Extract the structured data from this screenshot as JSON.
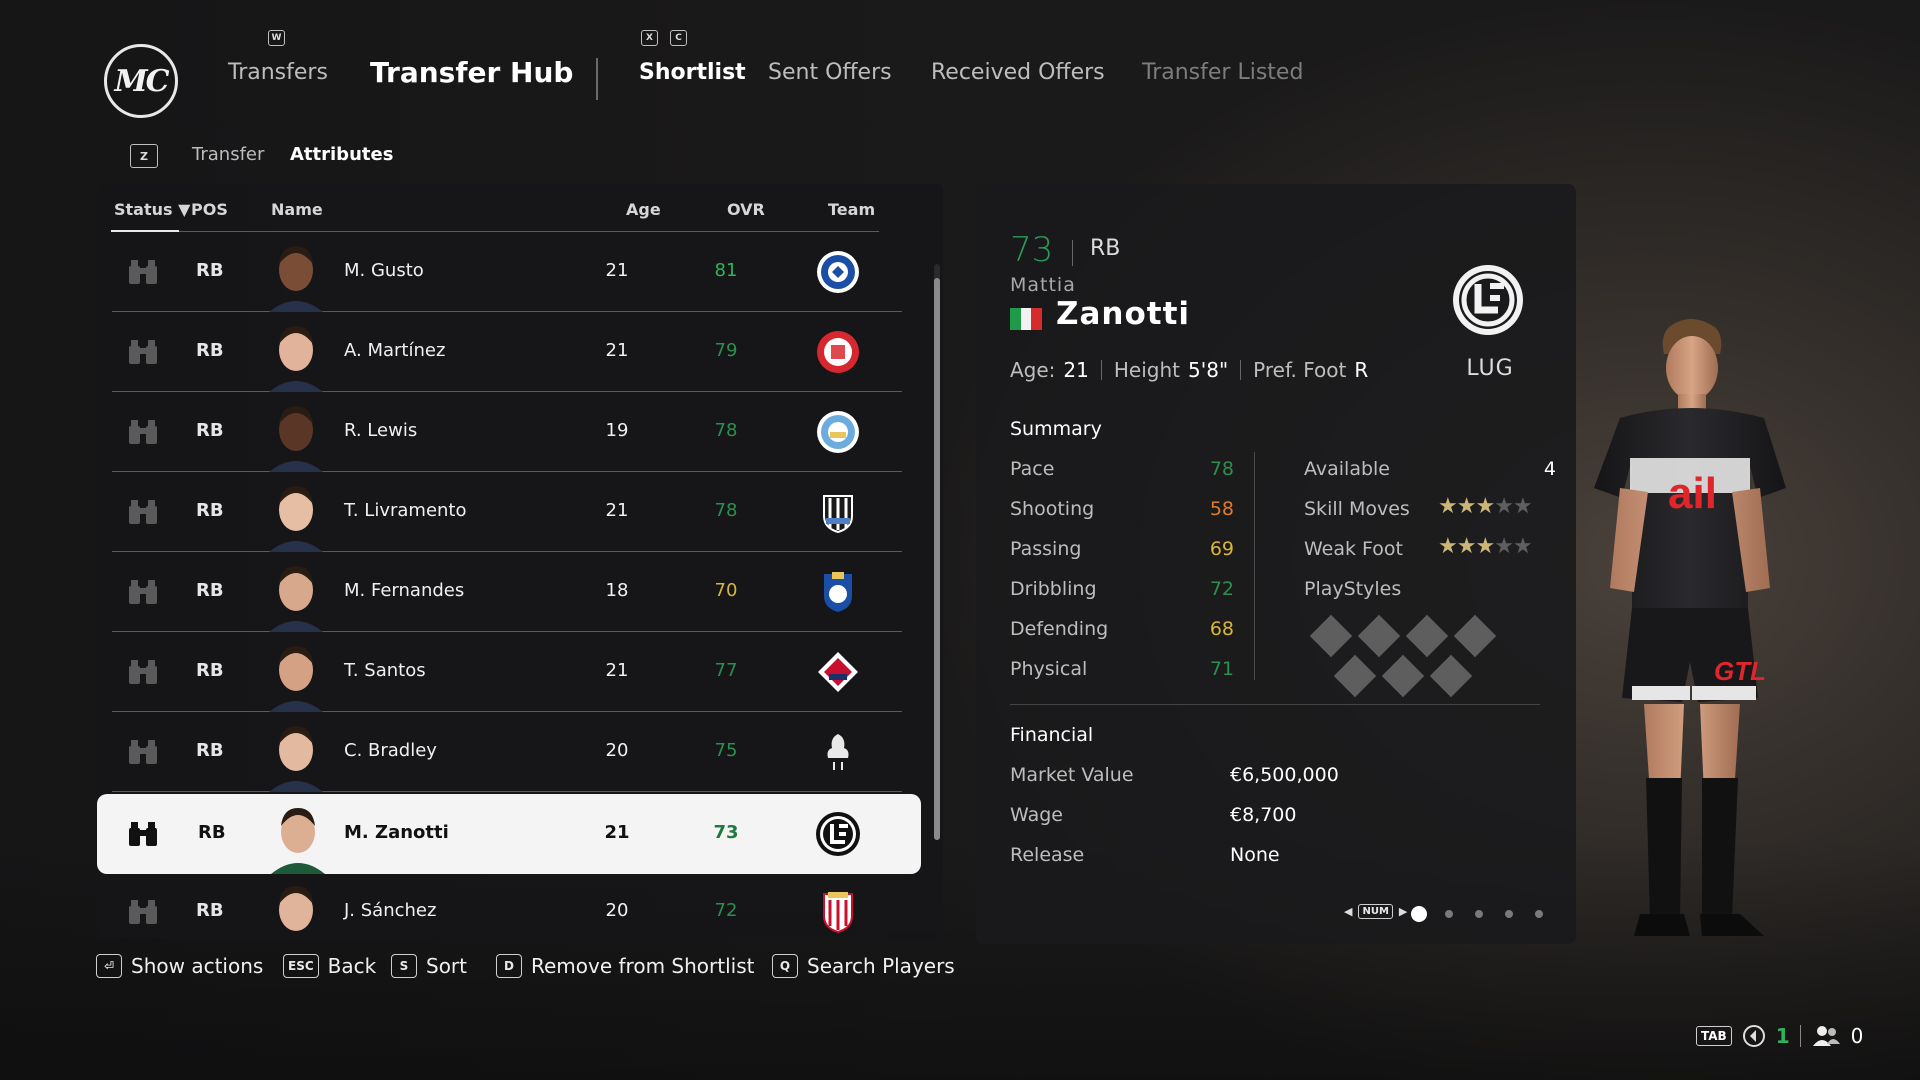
{
  "header": {
    "logo_text": "MC",
    "key_transfers": "W",
    "key_tabs_left": "X",
    "key_tabs_right": "C",
    "transfers": "Transfers",
    "title": "Transfer Hub",
    "tabs": [
      {
        "label": "Shortlist",
        "state": "active"
      },
      {
        "label": "Sent Offers",
        "state": "normal"
      },
      {
        "label": "Received Offers",
        "state": "normal"
      },
      {
        "label": "Transfer Listed",
        "state": "dim"
      }
    ]
  },
  "subnav": {
    "key": "Z",
    "transfer": "Transfer",
    "attributes": "Attributes"
  },
  "table": {
    "headers": {
      "status": "Status",
      "pos": "POS",
      "name": "Name",
      "age": "Age",
      "ovr": "OVR",
      "team": "Team"
    },
    "rows": [
      {
        "pos": "RB",
        "name": "M. Gusto",
        "age": "21",
        "ovr": "81",
        "ovr_color": "#2db35d",
        "club_icon": "chelsea-crest-icon",
        "skin": "#7a4e36"
      },
      {
        "pos": "RB",
        "name": "A. Martínez",
        "age": "21",
        "ovr": "79",
        "ovr_color": "#2d8f4f",
        "club_icon": "girona-crest-icon",
        "skin": "#e0b39a"
      },
      {
        "pos": "RB",
        "name": "R. Lewis",
        "age": "19",
        "ovr": "78",
        "ovr_color": "#2d8f4f",
        "club_icon": "man-city-crest-icon",
        "skin": "#5a3626"
      },
      {
        "pos": "RB",
        "name": "T. Livramento",
        "age": "21",
        "ovr": "78",
        "ovr_color": "#2d8f4f",
        "club_icon": "newcastle-crest-icon",
        "skin": "#e6bea4"
      },
      {
        "pos": "RB",
        "name": "M. Fernandes",
        "age": "18",
        "ovr": "70",
        "ovr_color": "#d9b63a",
        "club_icon": "porto-crest-icon",
        "skin": "#d8a88c"
      },
      {
        "pos": "RB",
        "name": "T. Santos",
        "age": "21",
        "ovr": "77",
        "ovr_color": "#2d8f4f",
        "club_icon": "lille-crest-icon",
        "skin": "#d4a184"
      },
      {
        "pos": "RB",
        "name": "C. Bradley",
        "age": "20",
        "ovr": "75",
        "ovr_color": "#2d8f4f",
        "club_icon": "liverpool-crest-icon",
        "skin": "#e3b9a0"
      },
      {
        "pos": "RB",
        "name": "M. Zanotti",
        "age": "21",
        "ovr": "73",
        "ovr_color": "#1e7a3e",
        "club_icon": "lugano-crest-icon",
        "skin": "#dcae92",
        "selected": true
      },
      {
        "pos": "RB",
        "name": "J. Sánchez",
        "age": "20",
        "ovr": "72",
        "ovr_color": "#2d8f4f",
        "club_icon": "sevilla-crest-icon",
        "skin": "#e0b49a"
      }
    ]
  },
  "detail": {
    "ovr": "73",
    "pos": "RB",
    "first_name": "Mattia",
    "last_name": "Zanotti",
    "nationality_flag": "italy-flag-icon",
    "club_abbr": "LUG",
    "age_label": "Age:",
    "age": "21",
    "height_label": "Height",
    "height": "5'8\"",
    "foot_label": "Pref. Foot",
    "foot": "R",
    "summary_title": "Summary",
    "stats": [
      {
        "label": "Pace",
        "value": "78",
        "color": "#2d8f4f"
      },
      {
        "label": "Shooting",
        "value": "58",
        "color": "#e07a2c"
      },
      {
        "label": "Passing",
        "value": "69",
        "color": "#d9b63a"
      },
      {
        "label": "Dribbling",
        "value": "72",
        "color": "#2d8f4f"
      },
      {
        "label": "Defending",
        "value": "68",
        "color": "#d9b63a"
      },
      {
        "label": "Physical",
        "value": "71",
        "color": "#2d8f4f"
      }
    ],
    "available_label": "Available",
    "available": "4",
    "skill_moves_label": "Skill Moves",
    "skill_moves": 3,
    "weak_foot_label": "Weak Foot",
    "weak_foot": 3,
    "star_max": 5,
    "playstyles_label": "PlayStyles",
    "financial_title": "Financial",
    "financial": [
      {
        "label": "Market Value",
        "value": "€6,500,000"
      },
      {
        "label": "Wage",
        "value": "€8,700"
      },
      {
        "label": "Release",
        "value": "None"
      }
    ],
    "pager_key": "NUM",
    "pages": 5,
    "active_page": 1
  },
  "actions": [
    {
      "key": "⏎",
      "label": "Show actions"
    },
    {
      "key": "ESC",
      "label": "Back"
    },
    {
      "key": "S",
      "label": "Sort"
    },
    {
      "key": "D",
      "label": "Remove from Shortlist"
    },
    {
      "key": "Q",
      "label": "Search Players"
    }
  ],
  "status_bar": {
    "key": "TAB",
    "count_a": "1",
    "count_b": "0"
  },
  "colors": {
    "accent_green": "#2d8f4f",
    "gold_star": "#cbb577"
  }
}
